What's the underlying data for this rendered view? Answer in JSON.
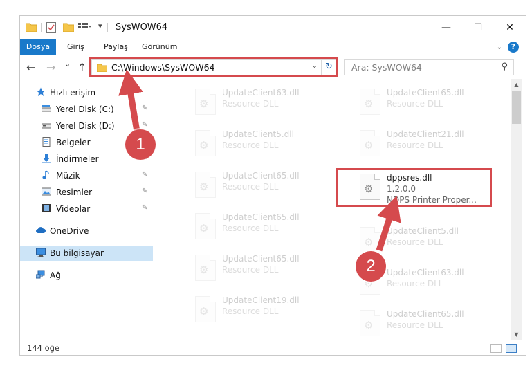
{
  "window": {
    "title": "SysWOW64",
    "minimize_glyph": "—",
    "maximize_glyph": "☐",
    "close_glyph": "✕"
  },
  "ribbon": {
    "tabs": [
      "Dosya",
      "Giriş",
      "Paylaş",
      "Görünüm"
    ],
    "help_glyph": "?"
  },
  "navbar": {
    "back_glyph": "←",
    "forward_glyph": "→",
    "recent_glyph": "⌄",
    "up_glyph": "↑",
    "address": "C:\\Windows\\SysWOW64",
    "dropdown_glyph": "⌄",
    "refresh_glyph": "↻",
    "search_placeholder": "Ara: SysWOW64",
    "search_glyph": "⚲"
  },
  "sidebar": {
    "items": [
      {
        "label": "Hızlı erişim",
        "icon": "star-icon",
        "pinned": false
      },
      {
        "label": "Yerel Disk (C:)",
        "icon": "drive-icon",
        "pinned": true
      },
      {
        "label": "Yerel Disk (D:)",
        "icon": "drive-icon",
        "pinned": true
      },
      {
        "label": "Belgeler",
        "icon": "document-icon",
        "pinned": true
      },
      {
        "label": "İndirmeler",
        "icon": "download-icon",
        "pinned": true
      },
      {
        "label": "Müzik",
        "icon": "music-icon",
        "pinned": true
      },
      {
        "label": "Resimler",
        "icon": "picture-icon",
        "pinned": true
      },
      {
        "label": "Videolar",
        "icon": "video-icon",
        "pinned": true
      },
      {
        "label": "OneDrive",
        "icon": "cloud-icon",
        "pinned": false
      },
      {
        "label": "Bu bilgisayar",
        "icon": "computer-icon",
        "pinned": false
      },
      {
        "label": "Ağ",
        "icon": "network-icon",
        "pinned": false
      }
    ],
    "pin_glyph": "📌"
  },
  "files": {
    "left_column": [
      {
        "name": "UpdateClient63.dll",
        "type": "Resource DLL"
      },
      {
        "name": "UpdateClient5.dll",
        "type": "Resource DLL"
      },
      {
        "name": "UpdateClient65.dll",
        "type": "Resource DLL"
      },
      {
        "name": "UpdateClient65.dll",
        "type": "Resource DLL"
      },
      {
        "name": "UpdateClient65.dll",
        "type": "Resource DLL"
      },
      {
        "name": "UpdateClient19.dll",
        "type": "Resource DLL"
      }
    ],
    "right_column": [
      {
        "name": "UpdateClient65.dll",
        "type": "Resource DLL"
      },
      {
        "name": "UpdateClient21.dll",
        "type": "Resource DLL"
      },
      {
        "name": "dppsres.dll",
        "version": "1.2.0.0",
        "description": "NDPS Printer Proper...",
        "highlighted": true
      },
      {
        "name": "UpdateClient5.dll",
        "type": "Resource DLL"
      },
      {
        "name": "UpdateClient63.dll",
        "type": "Resource DLL"
      },
      {
        "name": "UpdateClient65.dll",
        "type": "Resource DLL"
      }
    ],
    "gear_glyph": "⚙"
  },
  "status": {
    "count": "144 öğe"
  },
  "annotations": {
    "step1": "1",
    "step2": "2"
  },
  "colors": {
    "accent": "#1979ca",
    "highlight_red": "#d54a4d",
    "selected_bg": "#cce4f7"
  }
}
